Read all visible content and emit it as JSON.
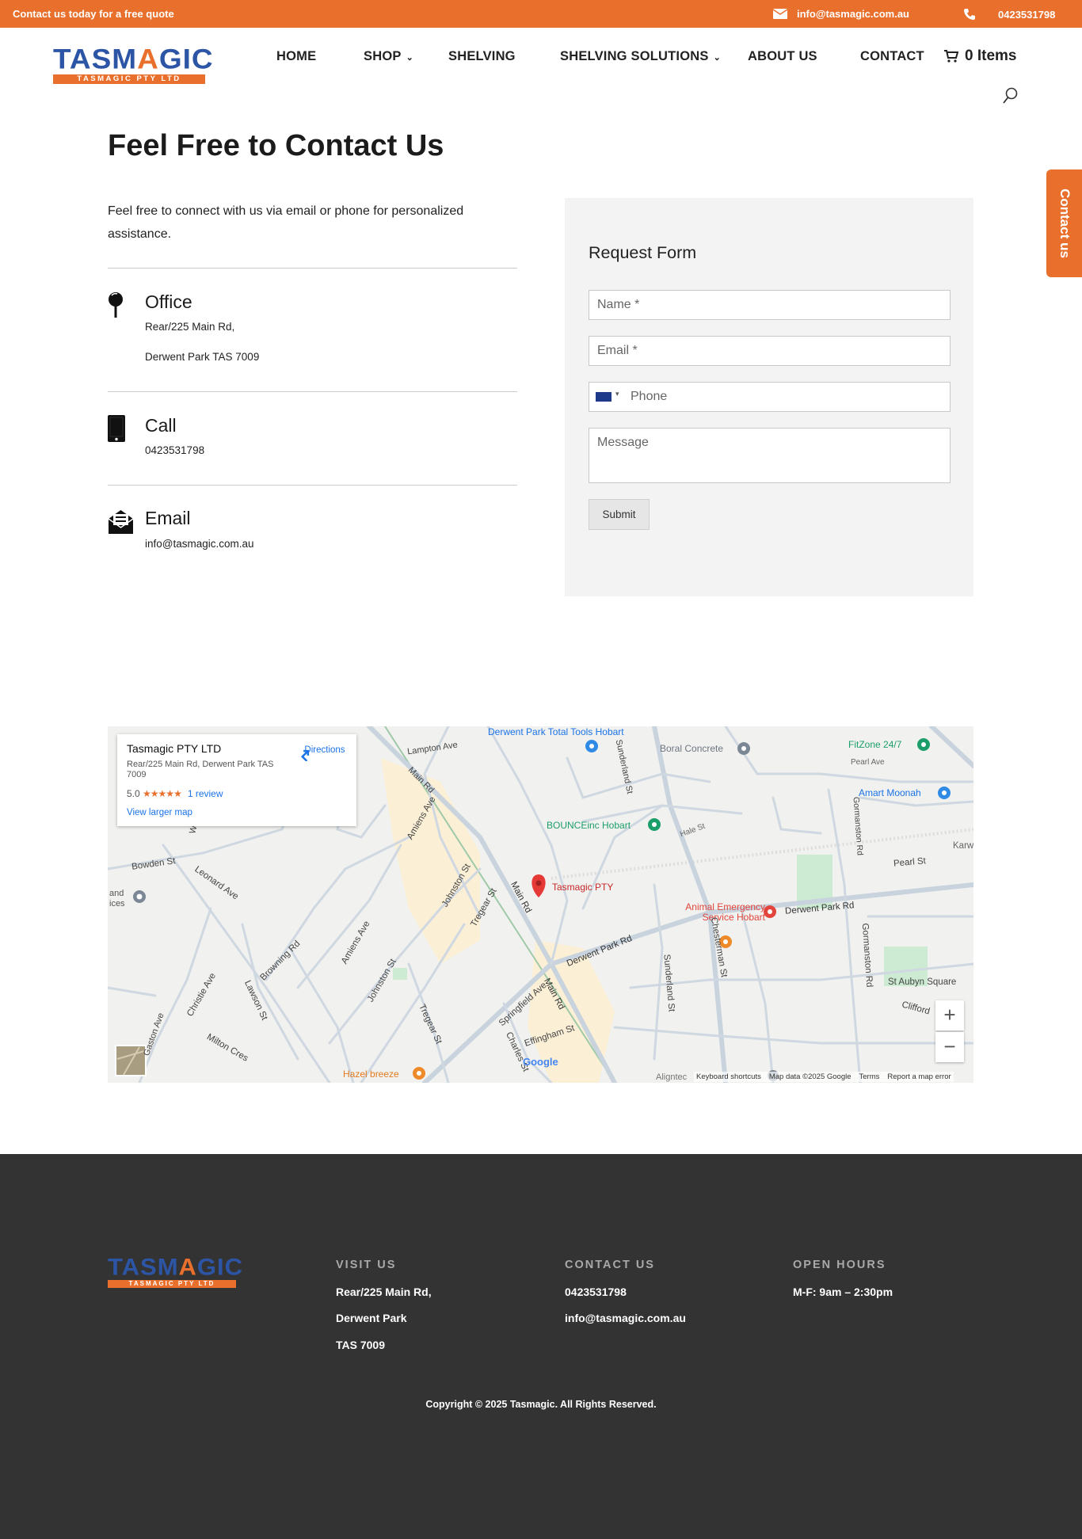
{
  "topbar": {
    "promo": "Contact us today for a free quote",
    "email": "info@tasmagic.com.au",
    "phone": "0423531798"
  },
  "logo": {
    "wordmark_a": "TASM",
    "wordmark_b": "A",
    "wordmark_c": "GIC",
    "tagline": "TASMAGIC PTY LTD"
  },
  "nav": {
    "home": "HOME",
    "shop": "SHOP",
    "shelving": "SHELVING",
    "solutions": "SHELVING SOLUTIONS",
    "about": "ABOUT US",
    "contact": "CONTACT",
    "cart": "0 Items"
  },
  "page": {
    "title": "Feel Free to Contact Us",
    "intro": "Feel free to connect with us via email or phone for personalized assistance.",
    "office": {
      "title": "Office",
      "line1": "Rear/225 Main Rd,",
      "line2": "Derwent Park TAS 7009"
    },
    "call": {
      "title": "Call",
      "line1": "0423531798"
    },
    "email": {
      "title": "Email",
      "line1": "info@tasmagic.com.au"
    }
  },
  "form": {
    "title": "Request Form",
    "name_placeholder": "Name *",
    "email_placeholder": "Email *",
    "phone_placeholder": "Phone",
    "message_placeholder": "Message",
    "submit": "Submit"
  },
  "side_tab": "Contact us",
  "map": {
    "card_title": "Tasmagic PTY LTD",
    "card_address": "Rear/225 Main Rd, Derwent Park TAS 7009",
    "rating": "5.0",
    "stars": "★★★★★",
    "reviews": "1 review",
    "larger": "View larger map",
    "directions": "Directions",
    "pin_label": "Tasmagic PTY",
    "places": [
      "Derwent Park Total Tools Hobart",
      "Boral Concrete",
      "FitZone 24/7",
      "Amart Moonah",
      "BOUNCEinc Hobart",
      "Animal Emergency Service Hobart",
      "Hazel breeze"
    ],
    "streets": [
      "Lampton Ave",
      "Main Rd",
      "Sunderland St",
      "Pearl Ave",
      "Hale St",
      "Gormanston Rd",
      "Pearl St",
      "Derwent Park Rd",
      "Bowden St",
      "Leonard Ave",
      "Amiens Ave",
      "Johnston St",
      "Tregear St",
      "Browning Rd",
      "Christie Ave",
      "Lawson St",
      "Milton Cres",
      "Springfield Ave",
      "Effingham St",
      "Charles St",
      "Chesterman St",
      "St Aubyn Square",
      "Clifford",
      "Karw",
      "Windsor",
      "Gaston Ave",
      "and",
      "ices",
      "Aligntec"
    ],
    "footer": [
      "Keyboard shortcuts",
      "Map data ©2025 Google",
      "Terms",
      "Report a map error"
    ],
    "google": "Google",
    "zoom_in": "+",
    "zoom_out": "−"
  },
  "footer": {
    "visit_head": "VISIT US",
    "visit_1": "Rear/225 Main Rd,",
    "visit_2": "Derwent Park",
    "visit_3": "TAS 7009",
    "contact_head": "CONTACT US",
    "contact_phone": "0423531798",
    "contact_email": "info@tasmagic.com.au",
    "hours_head": "OPEN HOURS",
    "hours": "M-F: 9am – 2:30pm",
    "copyright": "Copyright © 2025 Tasmagic. All Rights Reserved."
  },
  "colors": {
    "accent": "#e8702c",
    "brand_blue": "#2d55a5",
    "footer_bg": "#333333",
    "link_blue": "#1a73e8"
  }
}
